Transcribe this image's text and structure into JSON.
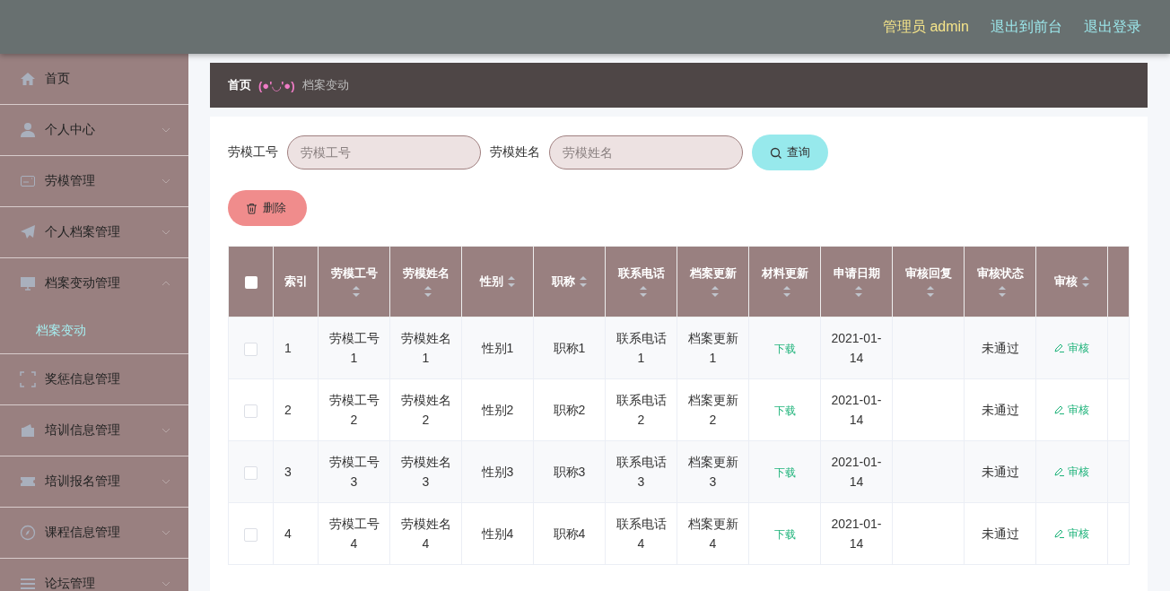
{
  "header": {
    "user": "管理员 admin",
    "links": [
      "退出到前台",
      "退出登录"
    ]
  },
  "sidebar": {
    "items": [
      {
        "label": "首页",
        "kind": "link"
      },
      {
        "label": "个人中心",
        "kind": "menu",
        "expanded": false
      },
      {
        "label": "劳模管理",
        "kind": "menu",
        "expanded": false
      },
      {
        "label": "个人档案管理",
        "kind": "menu",
        "expanded": false
      },
      {
        "label": "档案变动管理",
        "kind": "menu",
        "expanded": true,
        "children": [
          {
            "label": "档案变动",
            "selected": true
          }
        ]
      },
      {
        "label": "奖惩信息管理",
        "kind": "link"
      },
      {
        "label": "培训信息管理",
        "kind": "menu",
        "expanded": false
      },
      {
        "label": "培训报名管理",
        "kind": "menu",
        "expanded": false
      },
      {
        "label": "课程信息管理",
        "kind": "menu",
        "expanded": false
      },
      {
        "label": "论坛管理",
        "kind": "menu",
        "expanded": false
      }
    ]
  },
  "breadcrumb": {
    "home": "首页",
    "separator": "(●'◡'●)",
    "current": "档案变动"
  },
  "search": {
    "fields": [
      {
        "label": "劳模工号",
        "placeholder": "劳模工号"
      },
      {
        "label": "劳模姓名",
        "placeholder": "劳模姓名"
      }
    ],
    "button": "查询"
  },
  "delete_button": "删除",
  "table": {
    "select_all_checked": false,
    "columns": [
      {
        "label": "索引",
        "sortable": false
      },
      {
        "label": "劳模工号",
        "sortable": true
      },
      {
        "label": "劳模姓名",
        "sortable": true
      },
      {
        "label": "性别",
        "sortable": true
      },
      {
        "label": "职称",
        "sortable": true
      },
      {
        "label": "联系电话",
        "sortable": true
      },
      {
        "label": "档案更新",
        "sortable": true
      },
      {
        "label": "材料更新",
        "sortable": true
      },
      {
        "label": "申请日期",
        "sortable": true
      },
      {
        "label": "审核回复",
        "sortable": true
      },
      {
        "label": "审核状态",
        "sortable": true
      },
      {
        "label": "审核",
        "sortable": true
      }
    ],
    "rows": [
      {
        "checked": false,
        "cells": [
          {
            "kind": "text",
            "text": "1"
          },
          {
            "kind": "text",
            "text": "劳模工号1"
          },
          {
            "kind": "text",
            "text": "劳模姓名1"
          },
          {
            "kind": "text",
            "text": "性别1"
          },
          {
            "kind": "text",
            "text": "职称1"
          },
          {
            "kind": "text",
            "text": "联系电话1"
          },
          {
            "kind": "text",
            "text": "档案更新1"
          },
          {
            "kind": "link",
            "text": "下载"
          },
          {
            "kind": "text",
            "text": "2021-01-14"
          },
          {
            "kind": "empty"
          },
          {
            "kind": "text",
            "text": "未通过"
          },
          {
            "kind": "action",
            "text": "审核"
          }
        ]
      },
      {
        "checked": false,
        "cells": [
          {
            "kind": "text",
            "text": "2"
          },
          {
            "kind": "text",
            "text": "劳模工号2"
          },
          {
            "kind": "text",
            "text": "劳模姓名2"
          },
          {
            "kind": "text",
            "text": "性别2"
          },
          {
            "kind": "text",
            "text": "职称2"
          },
          {
            "kind": "text",
            "text": "联系电话2"
          },
          {
            "kind": "text",
            "text": "档案更新2"
          },
          {
            "kind": "link",
            "text": "下载"
          },
          {
            "kind": "text",
            "text": "2021-01-14"
          },
          {
            "kind": "empty"
          },
          {
            "kind": "text",
            "text": "未通过"
          },
          {
            "kind": "action",
            "text": "审核"
          }
        ]
      },
      {
        "checked": false,
        "cells": [
          {
            "kind": "text",
            "text": "3"
          },
          {
            "kind": "text",
            "text": "劳模工号3"
          },
          {
            "kind": "text",
            "text": "劳模姓名3"
          },
          {
            "kind": "text",
            "text": "性别3"
          },
          {
            "kind": "text",
            "text": "职称3"
          },
          {
            "kind": "text",
            "text": "联系电话3"
          },
          {
            "kind": "text",
            "text": "档案更新3"
          },
          {
            "kind": "link",
            "text": "下载"
          },
          {
            "kind": "text",
            "text": "2021-01-14"
          },
          {
            "kind": "empty"
          },
          {
            "kind": "text",
            "text": "未通过"
          },
          {
            "kind": "action",
            "text": "审核"
          }
        ]
      },
      {
        "checked": false,
        "cells": [
          {
            "kind": "text",
            "text": "4"
          },
          {
            "kind": "text",
            "text": "劳模工号4"
          },
          {
            "kind": "text",
            "text": "劳模姓名4"
          },
          {
            "kind": "text",
            "text": "性别4"
          },
          {
            "kind": "text",
            "text": "职称4"
          },
          {
            "kind": "text",
            "text": "联系电话4"
          },
          {
            "kind": "text",
            "text": "档案更新4"
          },
          {
            "kind": "link",
            "text": "下载"
          },
          {
            "kind": "text",
            "text": "2021-01-14"
          },
          {
            "kind": "empty"
          },
          {
            "kind": "text",
            "text": "未通过"
          },
          {
            "kind": "action",
            "text": "审核"
          }
        ]
      }
    ]
  }
}
